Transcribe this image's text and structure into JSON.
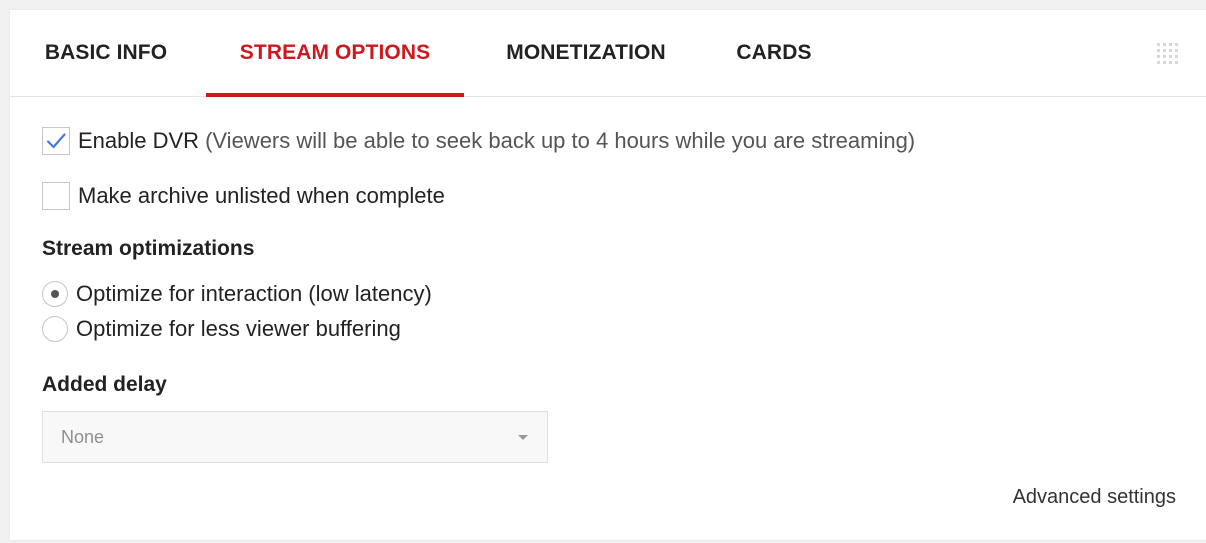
{
  "tabs": [
    {
      "label": "BASIC INFO",
      "active": false
    },
    {
      "label": "STREAM OPTIONS",
      "active": true
    },
    {
      "label": "MONETIZATION",
      "active": false
    },
    {
      "label": "CARDS",
      "active": false
    }
  ],
  "toolbar": {
    "grid_icon": "grid-dots-icon"
  },
  "options": {
    "enable_dvr": {
      "label": "Enable DVR",
      "hint": "(Viewers will be able to seek back up to 4 hours while you are streaming)",
      "checked": true
    },
    "unlisted_archive": {
      "label": "Make archive unlisted when complete",
      "checked": false
    }
  },
  "optimizations": {
    "title": "Stream optimizations",
    "items": [
      {
        "label": "Optimize for interaction (low latency)",
        "selected": true
      },
      {
        "label": "Optimize for less viewer buffering",
        "selected": false
      }
    ]
  },
  "delay": {
    "title": "Added delay",
    "selected": "None",
    "caret_icon": "caret-down-icon"
  },
  "advanced": {
    "label": "Advanced settings"
  },
  "colors": {
    "accent": "#cc181e",
    "text": "#222222",
    "muted": "#8f8f8f"
  }
}
